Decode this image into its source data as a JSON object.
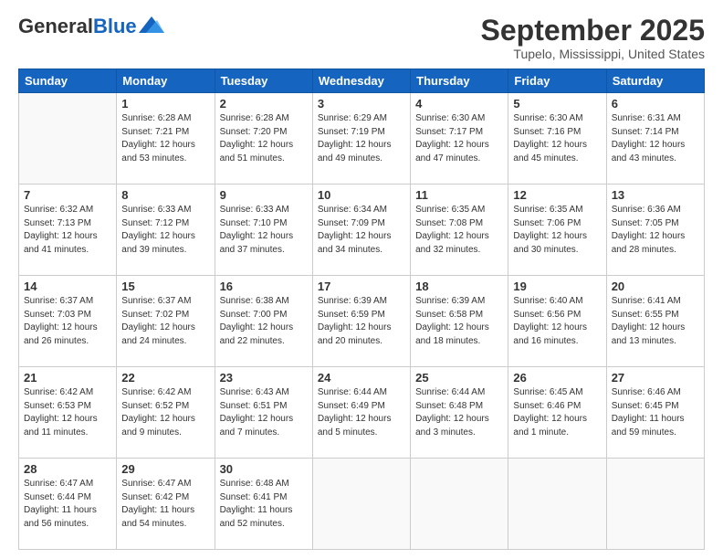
{
  "header": {
    "logo_general": "General",
    "logo_blue": "Blue",
    "month_title": "September 2025",
    "location": "Tupelo, Mississippi, United States"
  },
  "days_of_week": [
    "Sunday",
    "Monday",
    "Tuesday",
    "Wednesday",
    "Thursday",
    "Friday",
    "Saturday"
  ],
  "weeks": [
    [
      {
        "day": "",
        "info": ""
      },
      {
        "day": "1",
        "info": "Sunrise: 6:28 AM\nSunset: 7:21 PM\nDaylight: 12 hours\nand 53 minutes."
      },
      {
        "day": "2",
        "info": "Sunrise: 6:28 AM\nSunset: 7:20 PM\nDaylight: 12 hours\nand 51 minutes."
      },
      {
        "day": "3",
        "info": "Sunrise: 6:29 AM\nSunset: 7:19 PM\nDaylight: 12 hours\nand 49 minutes."
      },
      {
        "day": "4",
        "info": "Sunrise: 6:30 AM\nSunset: 7:17 PM\nDaylight: 12 hours\nand 47 minutes."
      },
      {
        "day": "5",
        "info": "Sunrise: 6:30 AM\nSunset: 7:16 PM\nDaylight: 12 hours\nand 45 minutes."
      },
      {
        "day": "6",
        "info": "Sunrise: 6:31 AM\nSunset: 7:14 PM\nDaylight: 12 hours\nand 43 minutes."
      }
    ],
    [
      {
        "day": "7",
        "info": "Sunrise: 6:32 AM\nSunset: 7:13 PM\nDaylight: 12 hours\nand 41 minutes."
      },
      {
        "day": "8",
        "info": "Sunrise: 6:33 AM\nSunset: 7:12 PM\nDaylight: 12 hours\nand 39 minutes."
      },
      {
        "day": "9",
        "info": "Sunrise: 6:33 AM\nSunset: 7:10 PM\nDaylight: 12 hours\nand 37 minutes."
      },
      {
        "day": "10",
        "info": "Sunrise: 6:34 AM\nSunset: 7:09 PM\nDaylight: 12 hours\nand 34 minutes."
      },
      {
        "day": "11",
        "info": "Sunrise: 6:35 AM\nSunset: 7:08 PM\nDaylight: 12 hours\nand 32 minutes."
      },
      {
        "day": "12",
        "info": "Sunrise: 6:35 AM\nSunset: 7:06 PM\nDaylight: 12 hours\nand 30 minutes."
      },
      {
        "day": "13",
        "info": "Sunrise: 6:36 AM\nSunset: 7:05 PM\nDaylight: 12 hours\nand 28 minutes."
      }
    ],
    [
      {
        "day": "14",
        "info": "Sunrise: 6:37 AM\nSunset: 7:03 PM\nDaylight: 12 hours\nand 26 minutes."
      },
      {
        "day": "15",
        "info": "Sunrise: 6:37 AM\nSunset: 7:02 PM\nDaylight: 12 hours\nand 24 minutes."
      },
      {
        "day": "16",
        "info": "Sunrise: 6:38 AM\nSunset: 7:00 PM\nDaylight: 12 hours\nand 22 minutes."
      },
      {
        "day": "17",
        "info": "Sunrise: 6:39 AM\nSunset: 6:59 PM\nDaylight: 12 hours\nand 20 minutes."
      },
      {
        "day": "18",
        "info": "Sunrise: 6:39 AM\nSunset: 6:58 PM\nDaylight: 12 hours\nand 18 minutes."
      },
      {
        "day": "19",
        "info": "Sunrise: 6:40 AM\nSunset: 6:56 PM\nDaylight: 12 hours\nand 16 minutes."
      },
      {
        "day": "20",
        "info": "Sunrise: 6:41 AM\nSunset: 6:55 PM\nDaylight: 12 hours\nand 13 minutes."
      }
    ],
    [
      {
        "day": "21",
        "info": "Sunrise: 6:42 AM\nSunset: 6:53 PM\nDaylight: 12 hours\nand 11 minutes."
      },
      {
        "day": "22",
        "info": "Sunrise: 6:42 AM\nSunset: 6:52 PM\nDaylight: 12 hours\nand 9 minutes."
      },
      {
        "day": "23",
        "info": "Sunrise: 6:43 AM\nSunset: 6:51 PM\nDaylight: 12 hours\nand 7 minutes."
      },
      {
        "day": "24",
        "info": "Sunrise: 6:44 AM\nSunset: 6:49 PM\nDaylight: 12 hours\nand 5 minutes."
      },
      {
        "day": "25",
        "info": "Sunrise: 6:44 AM\nSunset: 6:48 PM\nDaylight: 12 hours\nand 3 minutes."
      },
      {
        "day": "26",
        "info": "Sunrise: 6:45 AM\nSunset: 6:46 PM\nDaylight: 12 hours\nand 1 minute."
      },
      {
        "day": "27",
        "info": "Sunrise: 6:46 AM\nSunset: 6:45 PM\nDaylight: 11 hours\nand 59 minutes."
      }
    ],
    [
      {
        "day": "28",
        "info": "Sunrise: 6:47 AM\nSunset: 6:44 PM\nDaylight: 11 hours\nand 56 minutes."
      },
      {
        "day": "29",
        "info": "Sunrise: 6:47 AM\nSunset: 6:42 PM\nDaylight: 11 hours\nand 54 minutes."
      },
      {
        "day": "30",
        "info": "Sunrise: 6:48 AM\nSunset: 6:41 PM\nDaylight: 11 hours\nand 52 minutes."
      },
      {
        "day": "",
        "info": ""
      },
      {
        "day": "",
        "info": ""
      },
      {
        "day": "",
        "info": ""
      },
      {
        "day": "",
        "info": ""
      }
    ]
  ]
}
